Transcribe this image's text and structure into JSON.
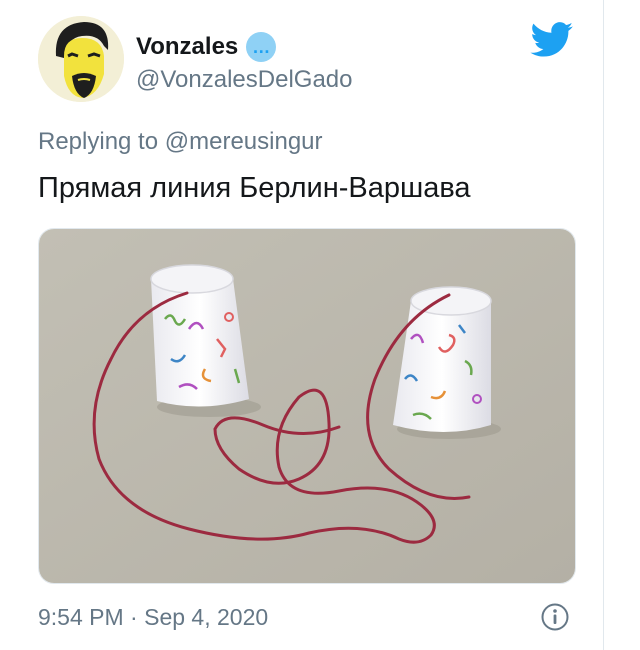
{
  "author": {
    "display_name": "Vonzales",
    "handle": "@VonzalesDelGado",
    "badge_symbol": "…"
  },
  "reply": {
    "prefix": "Replying to ",
    "mention": "@mereusingur"
  },
  "tweet": {
    "text": "Прямая линия Берлин-Варшава"
  },
  "meta": {
    "time": "9:54 PM",
    "separator": " · ",
    "date": "Sep 4, 2020"
  },
  "icons": {
    "brand": "twitter-bird-icon",
    "info": "info-icon",
    "badge": "speech-bubble-icon"
  },
  "colors": {
    "accent": "#1da1f2",
    "text_primary": "#14171a",
    "text_secondary": "#657786",
    "string": "#9c2a40"
  }
}
